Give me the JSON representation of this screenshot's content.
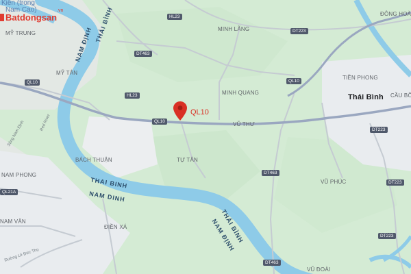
{
  "brand": {
    "name": "Batdongsan",
    "overlay_line1": "Kiến (trong",
    "overlay_line2": "Nam Cao)",
    "suffix": ".vn",
    "color": "#e03c31"
  },
  "marker": {
    "label": "QL10",
    "color": "#d93025"
  },
  "places": {
    "my_trung": "MỸ TRUNG",
    "my_tan": "MỸ TÂN",
    "minh_lang": "MINH LÃNG",
    "minh_quang": "MINH QUANG",
    "vu_thu": "VŨ THƯ",
    "bach_thuan": "BÁCH THUẬN",
    "tu_tan": "TỰ TÂN",
    "nam_phong": "NAM PHONG",
    "vu_phuc": "VŨ PHÚC",
    "nam_van": "NAM VÂN",
    "dien_xa": "ĐIỀN XÁ",
    "vu_doai": "VŨ ĐOÀI",
    "dong_hoa": "ĐÔNG HOÀ",
    "tien_phong": "TIỀN PHONG",
    "cau_bo": "CẦU BỒ",
    "thai_binh_city": "Thái Bình"
  },
  "rivers": {
    "red_river": "Red River",
    "song_nam_dinh": "Sông Nam Định"
  },
  "provinces": {
    "thai_binh_upper": "THÁI BÌNH",
    "nam_dinh_upper": "NAM ĐỊNH",
    "thai_binh_mid": "THAI BINH",
    "nam_dinh_mid": "NAM DINH",
    "thai_binh_right": "THÁI BÌNH",
    "nam_dinh_right": "NAM ĐỊNH"
  },
  "streets": {
    "le_duc_tho": "Đường Lê Đức Thọ"
  },
  "shields": {
    "hl23_top": "HL23",
    "dt463_left": "DT463",
    "dt223_top": "DT223",
    "ql10_left": "QL10",
    "ql10_mid": "QL10",
    "ql10_right": "QL10",
    "hl23_mid": "HL23",
    "dt223_right": "DT223",
    "dt463_mid": "DT463",
    "dt223_low": "DT223",
    "ql21a": "QL21A",
    "dt223_bottom": "DT223",
    "dt463_bottom": "DT463"
  },
  "colors": {
    "land_green": "#d6ecd6",
    "urban": "#e8ebee",
    "river": "#8ecbe8",
    "road": "#ffffff",
    "road_casing": "#c9cfd6",
    "highway": "#9aa7c0"
  }
}
